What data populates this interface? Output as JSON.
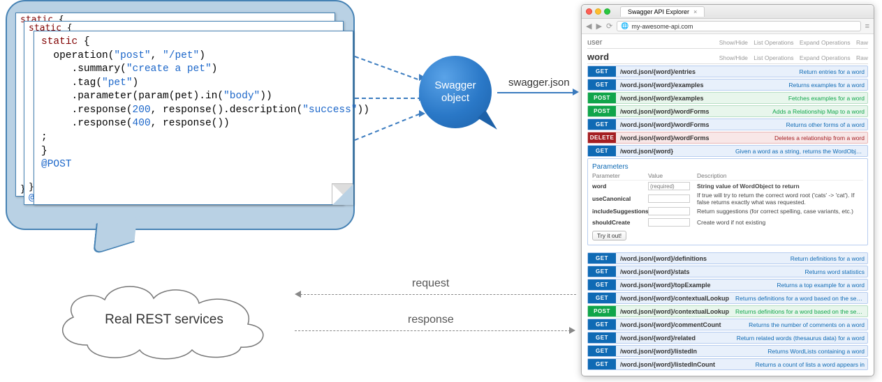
{
  "code": {
    "kw_static": "static",
    "lbrace": "{",
    "l1a": "  operation(",
    "l1s1": "\"post\"",
    "l1m": ", ",
    "l1s2": "\"/pet\"",
    "l1e": ")",
    "l2a": "     .summary(",
    "l2s": "\"create a pet\"",
    "l2e": ")",
    "l3a": "     .tag(",
    "l3s": "\"pet\"",
    "l3e": ")",
    "l4": "     .parameter(param(pet).in(",
    "l4s": "\"body\"",
    "l4e": "))",
    "l5a": "     .response(",
    "l5n": "200",
    "l5m": ", response().description(",
    "l5s": "\"success\"",
    "l5e": "))",
    "l6a": "     .response(",
    "l6n": "400",
    "l6e": ", response())",
    "semi": ";",
    "rbrace": "}",
    "post_anno": "@POST",
    "atmark": "@"
  },
  "swagger": {
    "line1": "Swagger",
    "line2": "object",
    "json_label": "swagger.json"
  },
  "labels": {
    "request": "request",
    "response": "response"
  },
  "cloud": {
    "text": "Real REST services"
  },
  "browser": {
    "tab_title": "Swagger API Explorer",
    "url": "my-awesome-api.com",
    "section_user": "user",
    "section_word": "word",
    "links": {
      "showhide": "Show/Hide",
      "list": "List Operations",
      "expand": "Expand Operations",
      "raw": "Raw"
    },
    "ops_top": [
      {
        "m": "GET",
        "p": "/word.json/{word}/entries",
        "d": "Return entries for a word"
      },
      {
        "m": "GET",
        "p": "/word.json/{word}/examples",
        "d": "Returns examples for a word"
      },
      {
        "m": "POST",
        "p": "/word.json/{word}/examples",
        "d": "Fetches examples for a word"
      },
      {
        "m": "POST",
        "p": "/word.json/{word}/wordForms",
        "d": "Adds a Relationship Map to a word"
      },
      {
        "m": "GET",
        "p": "/word.json/{word}/wordForms",
        "d": "Returns other forms of a word"
      },
      {
        "m": "DELETE",
        "p": "/word.json/{word}/wordForms",
        "d": "Deletes a relationship from a word"
      }
    ],
    "expanded": {
      "m": "GET",
      "p": "/word.json/{word}",
      "d": "Given a word as a string, returns the WordObject that represents it",
      "title": "Parameters",
      "head": {
        "c1": "Parameter",
        "c2": "Value",
        "c3": "Description"
      },
      "rows": [
        {
          "name": "word",
          "ph": "(required)",
          "desc": "String value of WordObject to return",
          "bold": true
        },
        {
          "name": "useCanonical",
          "ph": "",
          "desc": "If true will try to return the correct word root ('cats' -> 'cat'). If false returns exactly what was requested."
        },
        {
          "name": "includeSuggestions",
          "ph": "",
          "desc": "Return suggestions (for correct spelling, case variants, etc.)"
        },
        {
          "name": "shouldCreate",
          "ph": "",
          "desc": "Create word if not existing"
        }
      ],
      "tryit": "Try it out!"
    },
    "ops_bottom": [
      {
        "m": "GET",
        "p": "/word.json/{word}/definitions",
        "d": "Return definitions for a word"
      },
      {
        "m": "GET",
        "p": "/word.json/{word}/stats",
        "d": "Returns word statistics"
      },
      {
        "m": "GET",
        "p": "/word.json/{word}/topExample",
        "d": "Returns a top example for a word"
      },
      {
        "m": "GET",
        "p": "/word.json/{word}/contextualLookup",
        "d": "Returns definitions for a word based on the sentence in which it is found"
      },
      {
        "m": "POST",
        "p": "/word.json/{word}/contextualLookup",
        "d": "Returns definitions for a word based on the sentence in which it is found"
      },
      {
        "m": "GET",
        "p": "/word.json/{word}/commentCount",
        "d": "Returns the number of comments on a word"
      },
      {
        "m": "GET",
        "p": "/word.json/{word}/related",
        "d": "Return related words (thesaurus data) for a word"
      },
      {
        "m": "GET",
        "p": "/word.json/{word}/listedIn",
        "d": "Returns WordLists containing a word"
      },
      {
        "m": "GET",
        "p": "/word.json/{word}/listedInCount",
        "d": "Returns a count of lists a word appears in"
      }
    ]
  }
}
